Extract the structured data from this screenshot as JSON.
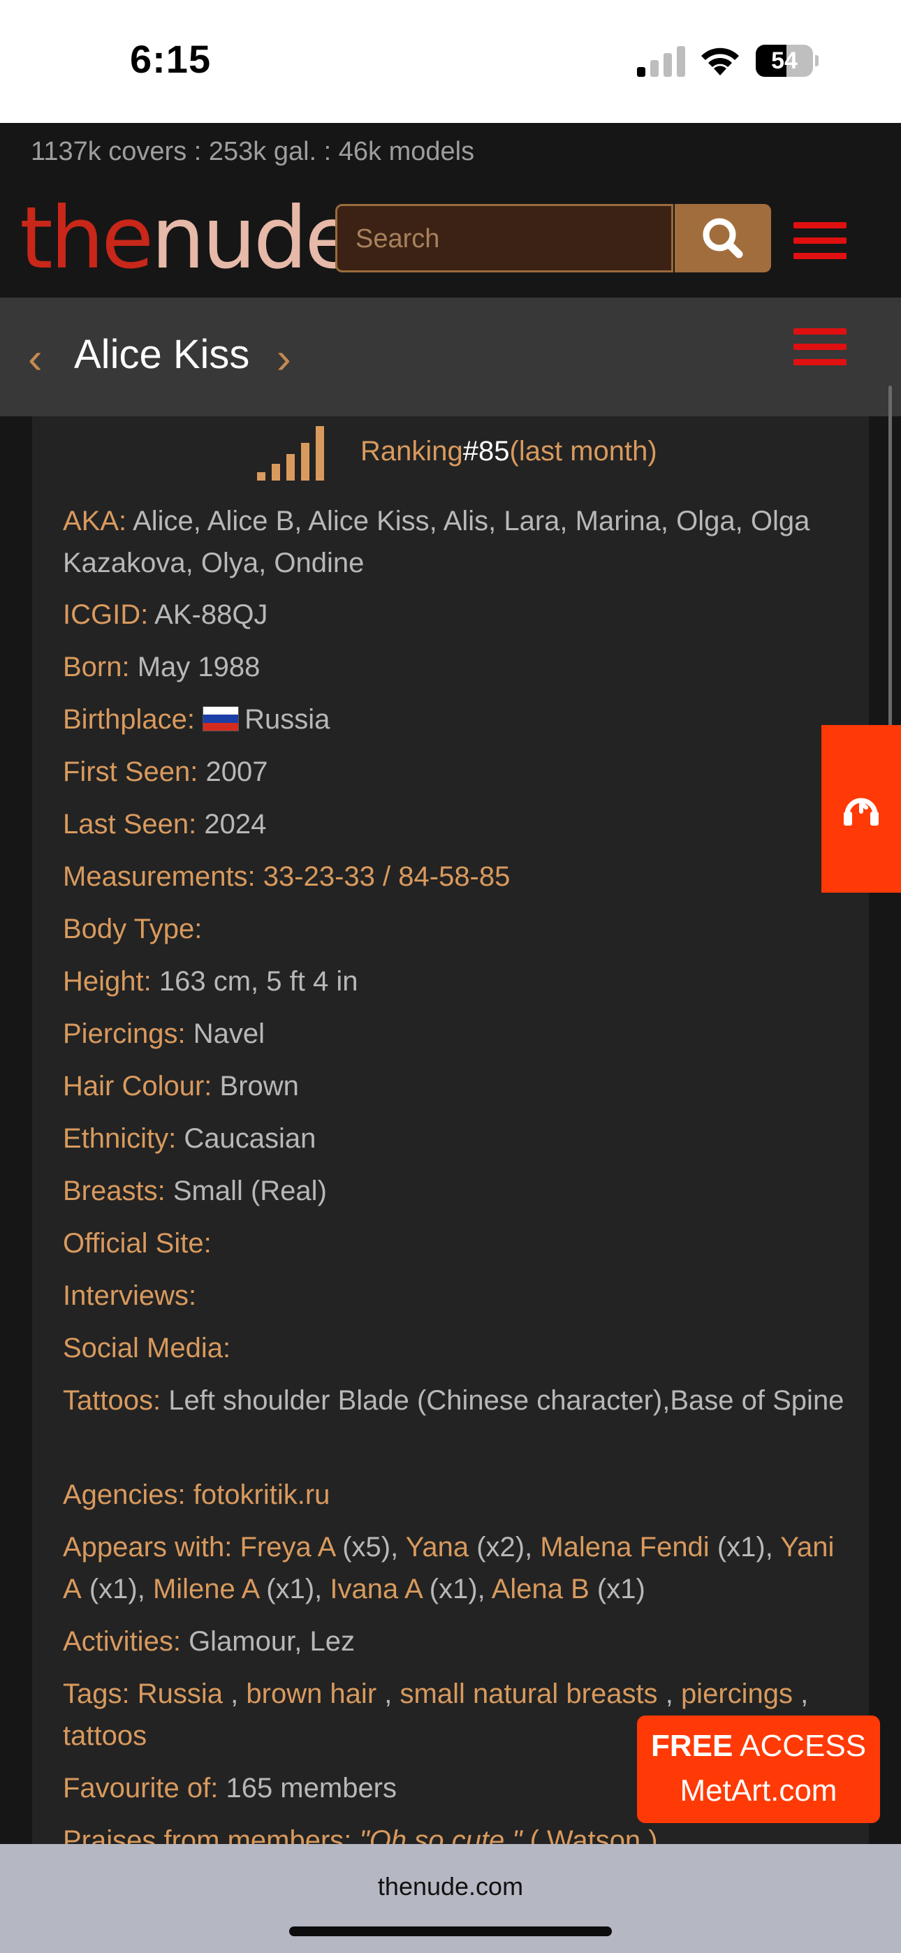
{
  "status": {
    "time": "6:15",
    "battery": "54",
    "battery_level": 0.54
  },
  "site": {
    "stats": "1137k covers : 253k gal. : 46k models",
    "logo_a": "the",
    "logo_b": "nude",
    "search_placeholder": "Search"
  },
  "model": {
    "name": "Alice Kiss",
    "prev": "‹",
    "next": "›"
  },
  "ranking": {
    "label": "Ranking",
    "value": "#85",
    "period": "(last month)"
  },
  "fields": {
    "aka_label": "AKA:",
    "aka_value": "Alice, Alice B, Alice Kiss, Alis, Lara, Marina, Olga, Olga Kazakova, Olya, Ondine",
    "icgid_label": "ICGID:",
    "icgid_value": "AK-88QJ",
    "born_label": "Born:",
    "born_value": "May 1988",
    "birthplace_label": "Birthplace:",
    "birthplace_value": "Russia",
    "first_seen_label": "First Seen:",
    "first_seen_value": "2007",
    "last_seen_label": "Last Seen:",
    "last_seen_value": "2024",
    "measurements_label": "Measurements:",
    "measurements_value": "33-23-33 / 84-58-85",
    "body_type_label": "Body Type:",
    "height_label": "Height:",
    "height_value": "163 cm, 5 ft 4 in",
    "piercings_label": "Piercings:",
    "piercings_value": "Navel",
    "hair_label": "Hair Colour:",
    "hair_value": "Brown",
    "ethnicity_label": "Ethnicity:",
    "ethnicity_value": "Caucasian",
    "breasts_label": "Breasts:",
    "breasts_value": "Small (Real)",
    "official_site_label": "Official Site:",
    "interviews_label": "Interviews:",
    "social_label": "Social Media:",
    "tattoos_label": "Tattoos:",
    "tattoos_value": "Left shoulder Blade (Chinese character),Base of Spine",
    "agencies_label": "Agencies:",
    "agencies_value": "fotokritik.ru",
    "appears_label": "Appears with:",
    "appears": [
      {
        "name": "Freya A",
        "count": "(x5)"
      },
      {
        "name": "Yana",
        "count": "(x2)"
      },
      {
        "name": "Malena Fendi",
        "count": "(x1)"
      },
      {
        "name": "Yani A",
        "count": "(x1)"
      },
      {
        "name": "Milene A",
        "count": "(x1)"
      },
      {
        "name": "Ivana A",
        "count": "(x1)"
      },
      {
        "name": "Alena B",
        "count": "(x1)"
      }
    ],
    "activities_label": "Activities:",
    "activities_value": "Glamour, Lez",
    "tags_label": "Tags:",
    "tags": [
      "Russia",
      "brown hair",
      "small natural breasts",
      "piercings",
      "tattoos"
    ],
    "favourite_label": "Favourite of:",
    "favourite_value": "165 members",
    "praises_label": "Praises from members:",
    "praises_quote": "\"Oh so cute.\"",
    "praises_by": "( Watson )"
  },
  "promo": {
    "line1_bold": "FREE",
    "line1_rest": " ACCESS",
    "line2": "MetArt.com"
  },
  "browser": {
    "url": "thenude.com"
  },
  "colors": {
    "accent_gold": "#d99a5e",
    "header_red": "#e01010",
    "promo_orange": "#ff3a06",
    "logo_red": "#c8271a",
    "logo_pink": "#e7b9a8"
  }
}
